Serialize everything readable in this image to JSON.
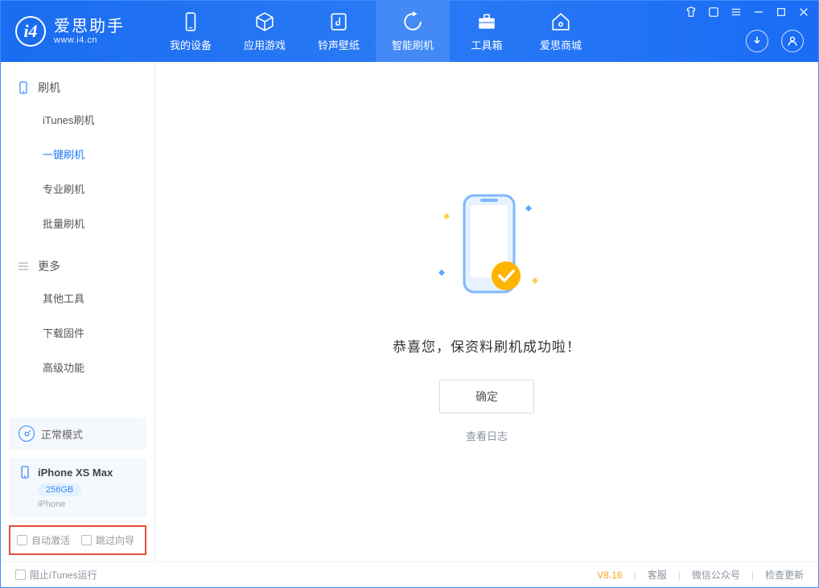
{
  "app": {
    "title": "爱思助手",
    "subtitle": "www.i4.cn"
  },
  "nav": [
    {
      "label": "我的设备",
      "icon": "device"
    },
    {
      "label": "应用游戏",
      "icon": "cube"
    },
    {
      "label": "铃声壁纸",
      "icon": "music"
    },
    {
      "label": "智能刷机",
      "icon": "refresh",
      "active": true
    },
    {
      "label": "工具箱",
      "icon": "toolbox"
    },
    {
      "label": "爱思商城",
      "icon": "home"
    }
  ],
  "sidebar": {
    "flash": {
      "title": "刷机",
      "items": [
        "iTunes刷机",
        "一键刷机",
        "专业刷机",
        "批量刷机"
      ],
      "active_index": 1
    },
    "more": {
      "title": "更多",
      "items": [
        "其他工具",
        "下载固件",
        "高级功能"
      ]
    },
    "mode": {
      "label": "正常模式"
    },
    "device": {
      "name": "iPhone XS Max",
      "capacity": "256GB",
      "type": "iPhone"
    },
    "checks": {
      "auto_activate": "自动激活",
      "skip_guide": "跳过向导"
    }
  },
  "content": {
    "success": "恭喜您，保资料刷机成功啦！",
    "ok": "确定",
    "view_log": "查看日志"
  },
  "statusbar": {
    "block_itunes": "阻止iTunes运行",
    "version": "V8.16",
    "links": [
      "客服",
      "微信公众号",
      "检查更新"
    ]
  },
  "colors": {
    "primary": "#1a7af5",
    "accent": "#ffb400"
  }
}
